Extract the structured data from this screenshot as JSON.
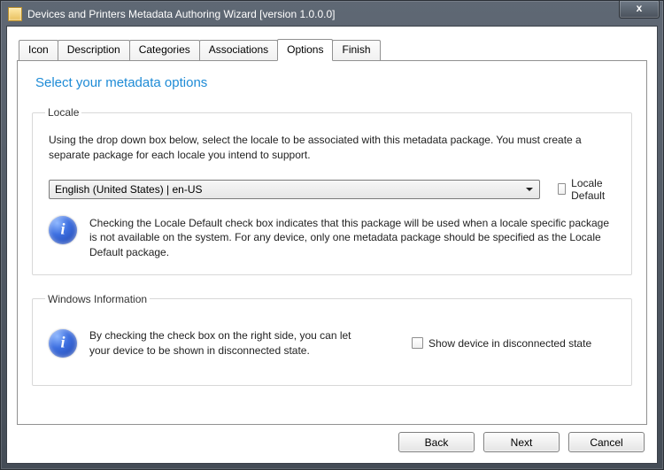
{
  "window": {
    "title": "Devices and Printers Metadata Authoring Wizard [version 1.0.0.0]"
  },
  "tabs": {
    "t0": "Icon",
    "t1": "Description",
    "t2": "Categories",
    "t3": "Associations",
    "t4": "Options",
    "t5": "Finish"
  },
  "heading": "Select your metadata options",
  "locale": {
    "legend": "Locale",
    "intro": "Using the drop down box below, select the locale to be associated with this metadata package. You must create a separate package for each locale you intend to support.",
    "selected": "English (United States) | en-US",
    "default_label": "Locale Default",
    "info": "Checking the Locale Default check box indicates that this package will be used when a locale specific package is not available on the system. For any device, only one metadata package should be specified as the Locale Default package."
  },
  "wininfo": {
    "legend": "Windows Information",
    "text": "By checking the check box on the right side, you can let your device to be shown in disconnected state.",
    "check_label": "Show device in disconnected state"
  },
  "buttons": {
    "back": "Back",
    "next": "Next",
    "cancel": "Cancel"
  }
}
